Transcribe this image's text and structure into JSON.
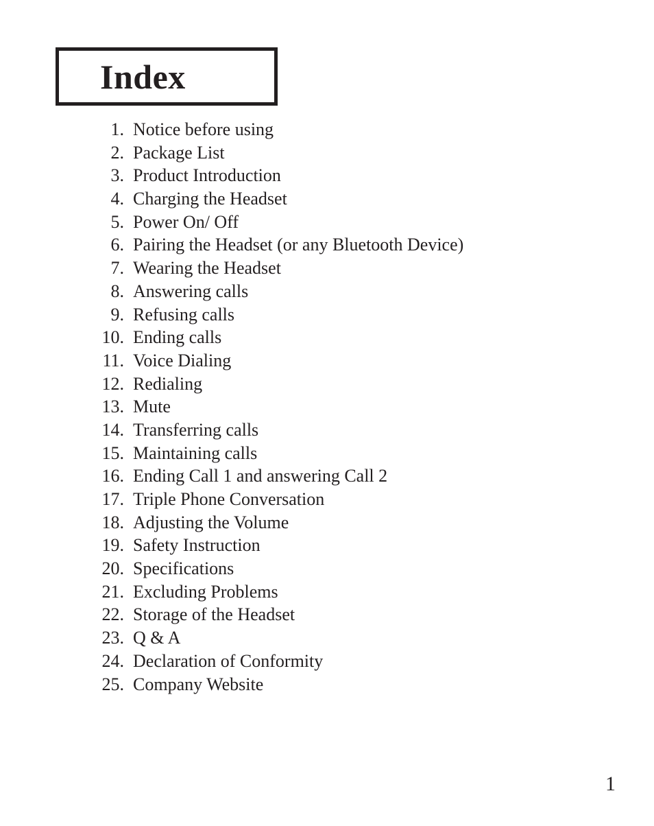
{
  "page": {
    "title": "Index",
    "page_number": "1",
    "text_color": "#231f20",
    "background_color": "#ffffff"
  },
  "index": {
    "items": [
      {
        "number": "1.",
        "label": "Notice before using"
      },
      {
        "number": "2.",
        "label": "Package List"
      },
      {
        "number": "3.",
        "label": "Product Introduction"
      },
      {
        "number": "4.",
        "label": "Charging the Headset"
      },
      {
        "number": "5.",
        "label": "Power On/ Off"
      },
      {
        "number": "6.",
        "label": "Pairing the Headset (or any Bluetooth Device)"
      },
      {
        "number": "7.",
        "label": "Wearing the Headset"
      },
      {
        "number": "8.",
        "label": "Answering calls"
      },
      {
        "number": "9.",
        "label": "Refusing calls"
      },
      {
        "number": "10.",
        "label": "Ending calls"
      },
      {
        "number": "11.",
        "label": "Voice Dialing"
      },
      {
        "number": "12.",
        "label": "Redialing"
      },
      {
        "number": "13.",
        "label": "Mute"
      },
      {
        "number": "14.",
        "label": "Transferring calls"
      },
      {
        "number": "15.",
        "label": "Maintaining calls"
      },
      {
        "number": "16.",
        "label": "Ending Call 1 and answering Call 2"
      },
      {
        "number": "17.",
        "label": "Triple Phone Conversation"
      },
      {
        "number": "18.",
        "label": "Adjusting the Volume"
      },
      {
        "number": "19.",
        "label": "Safety Instruction"
      },
      {
        "number": "20.",
        "label": "Specifications"
      },
      {
        "number": "21.",
        "label": "Excluding Problems"
      },
      {
        "number": "22.",
        "label": "Storage of the Headset"
      },
      {
        "number": "23.",
        "label": "Q & A"
      },
      {
        "number": "24.",
        "label": "Declaration of Conformity"
      },
      {
        "number": "25.",
        "label": "Company Website"
      }
    ]
  }
}
